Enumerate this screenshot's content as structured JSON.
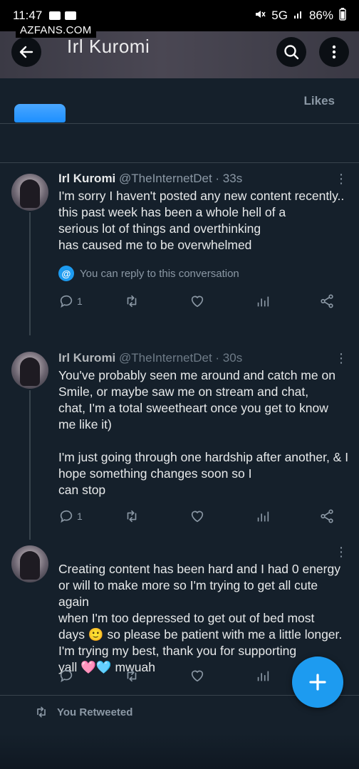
{
  "status_bar": {
    "time": "11:47",
    "network": "5G",
    "battery": "86%"
  },
  "watermark": "AZFANS.COM",
  "header": {
    "title": "Irl Kuromi"
  },
  "tabs": {
    "likes": "Likes"
  },
  "tweets": [
    {
      "name": "Irl Kuromi",
      "handle": "@TheInternetDet",
      "time": "· 33s",
      "body": "I'm sorry I haven't posted any new content recently..\nthis past week has been a whole hell of a\nserious lot of things and overthinking\nhas caused me to be overwhelmed",
      "notice": "You can reply to this conversation",
      "replies": "1",
      "retweets": "",
      "likes": "",
      "views": ""
    },
    {
      "name": "Irl Kuromi",
      "handle": "@TheInternetDet",
      "time": "· 30s",
      "body": "You've probably seen me around and catch me on\nSmile, or maybe saw me on stream and chat,\nchat, I'm a total sweetheart once you get to know\nme like it)\n\nI'm just going through one hardship after another, & I\nhope something changes soon so I\ncan stop",
      "replies": "1",
      "retweets": "",
      "likes": "",
      "views": ""
    },
    {
      "name": "",
      "handle": "",
      "time": "",
      "body": "Creating content has been hard and I had 0 energy\nor will to make more so I'm trying to get all cute again\nwhen I'm too depressed to get out of bed most\ndays 🙂 so please be patient with me a little longer.\nI'm trying my best, thank you for supporting\nyall 🩷🩵 mwuah",
      "replies": "",
      "retweets": "",
      "likes": "",
      "views": ""
    }
  ],
  "retweet_label": "You Retweeted",
  "colors": {
    "background": "#15202b",
    "accent": "#1d9bf0",
    "muted": "#8b98a5",
    "divider": "#38444d"
  }
}
